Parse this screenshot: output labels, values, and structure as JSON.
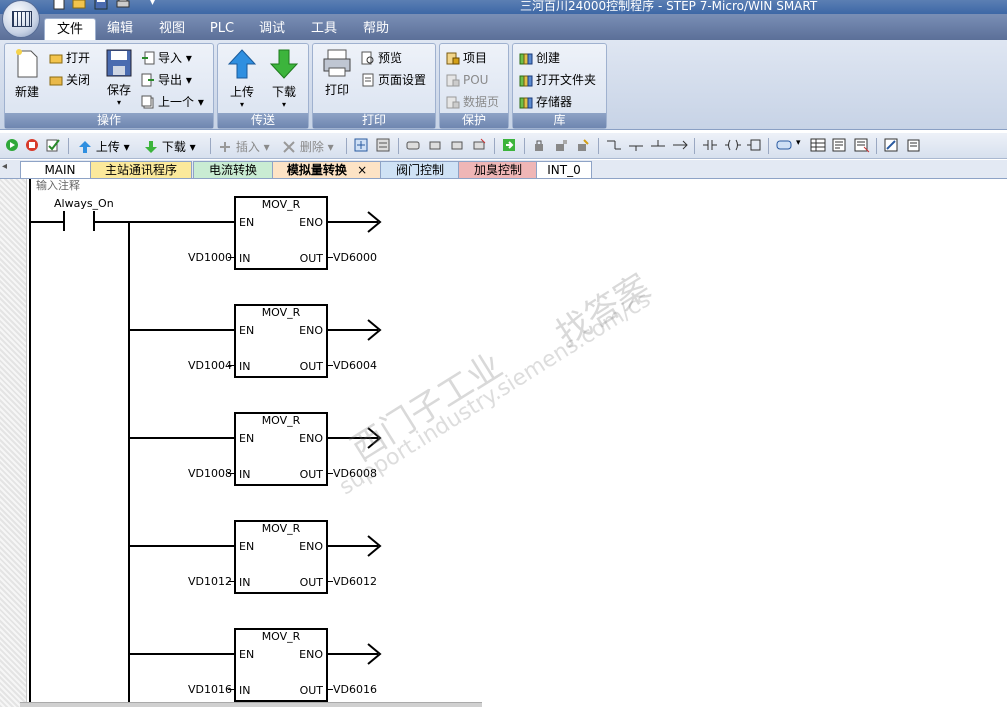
{
  "window": {
    "title": "三河百川24000控制程序 - STEP 7-Micro/WIN SMART"
  },
  "menu": [
    "文件",
    "编辑",
    "视图",
    "PLC",
    "调试",
    "工具",
    "帮助"
  ],
  "ribbon": {
    "operations": {
      "label": "操作",
      "new": "新建",
      "open": "打开",
      "close": "关闭",
      "save": "保存",
      "import": "导入",
      "export": "导出",
      "previous": "上一个"
    },
    "transfer": {
      "label": "传送",
      "upload": "上传",
      "download": "下载"
    },
    "print": {
      "label": "打印",
      "print": "打印",
      "preview": "预览",
      "page_setup": "页面设置"
    },
    "protect": {
      "label": "保护",
      "project": "项目",
      "pou": "POU",
      "data_page": "数据页"
    },
    "library": {
      "label": "库",
      "create": "创建",
      "open_folder": "打开文件夹",
      "memory": "存储器"
    }
  },
  "toolbar": {
    "upload": "上传",
    "download": "下载",
    "insert": "插入",
    "delete": "删除"
  },
  "tabs": [
    {
      "label": "MAIN",
      "color": "#ffffff"
    },
    {
      "label": "主站通讯程序",
      "color": "#fbe99b"
    },
    {
      "label": "电流转换",
      "color": "#c9ecd3"
    },
    {
      "label": "模拟量转换",
      "color": "#fde3c5"
    },
    {
      "label": "阀门控制",
      "color": "#cfe2f5"
    },
    {
      "label": "加臭控制",
      "color": "#efb6b6"
    },
    {
      "label": "INT_0",
      "color": "#ffffff"
    }
  ],
  "active_tab_close": "×",
  "network": {
    "comment": "输入注释",
    "contact": "Always_On",
    "blocks": [
      {
        "name": "MOV_R",
        "en": "EN",
        "eno": "ENO",
        "in_pin": "IN",
        "out_pin": "OUT",
        "in": "VD1000",
        "out": "VD6000"
      },
      {
        "name": "MOV_R",
        "en": "EN",
        "eno": "ENO",
        "in_pin": "IN",
        "out_pin": "OUT",
        "in": "VD1004",
        "out": "VD6004"
      },
      {
        "name": "MOV_R",
        "en": "EN",
        "eno": "ENO",
        "in_pin": "IN",
        "out_pin": "OUT",
        "in": "VD1008",
        "out": "VD6008"
      },
      {
        "name": "MOV_R",
        "en": "EN",
        "eno": "ENO",
        "in_pin": "IN",
        "out_pin": "OUT",
        "in": "VD1012",
        "out": "VD6012"
      },
      {
        "name": "MOV_R",
        "en": "EN",
        "eno": "ENO",
        "in_pin": "IN",
        "out_pin": "OUT",
        "in": "VD1016",
        "out": "VD6016"
      }
    ]
  },
  "watermark": {
    "line1": "西门子工业",
    "line2": "support.industry.siemens.com/cs",
    "line3": "找答案"
  }
}
